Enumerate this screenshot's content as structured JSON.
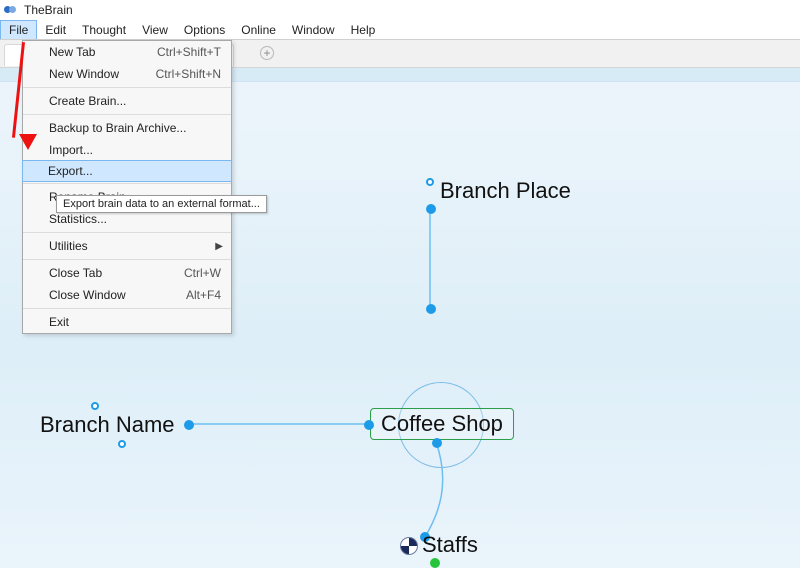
{
  "app": {
    "title": "TheBrain"
  },
  "menubar": {
    "items": [
      "File",
      "Edit",
      "Thought",
      "View",
      "Options",
      "Online",
      "Window",
      "Help"
    ],
    "active_index": 0
  },
  "file_menu": {
    "rows": [
      {
        "label": "New Tab",
        "shortcut": "Ctrl+Shift+T"
      },
      {
        "label": "New Window",
        "shortcut": "Ctrl+Shift+N"
      },
      {
        "label": "Create Brain...",
        "sep": true
      },
      {
        "label": "Backup to Brain Archive...",
        "sep": true
      },
      {
        "label": "Import..."
      },
      {
        "label": "Export...",
        "highlight": true
      },
      {
        "label": "Rename Brain",
        "sep": true
      },
      {
        "label": "Statistics..."
      },
      {
        "label": "Utilities",
        "submenu": true,
        "sep": true
      },
      {
        "label": "Close Tab",
        "shortcut": "Ctrl+W",
        "sep": true
      },
      {
        "label": "Close Window",
        "shortcut": "Alt+F4"
      },
      {
        "label": "Exit",
        "sep": true
      }
    ],
    "tooltip": "Export brain data to an external format..."
  },
  "plex": {
    "center": {
      "label": "Coffee Shop"
    },
    "parent": {
      "label": "Branch Place"
    },
    "sibling": {
      "label": "Branch Name"
    },
    "child": {
      "label": "Staffs"
    }
  }
}
